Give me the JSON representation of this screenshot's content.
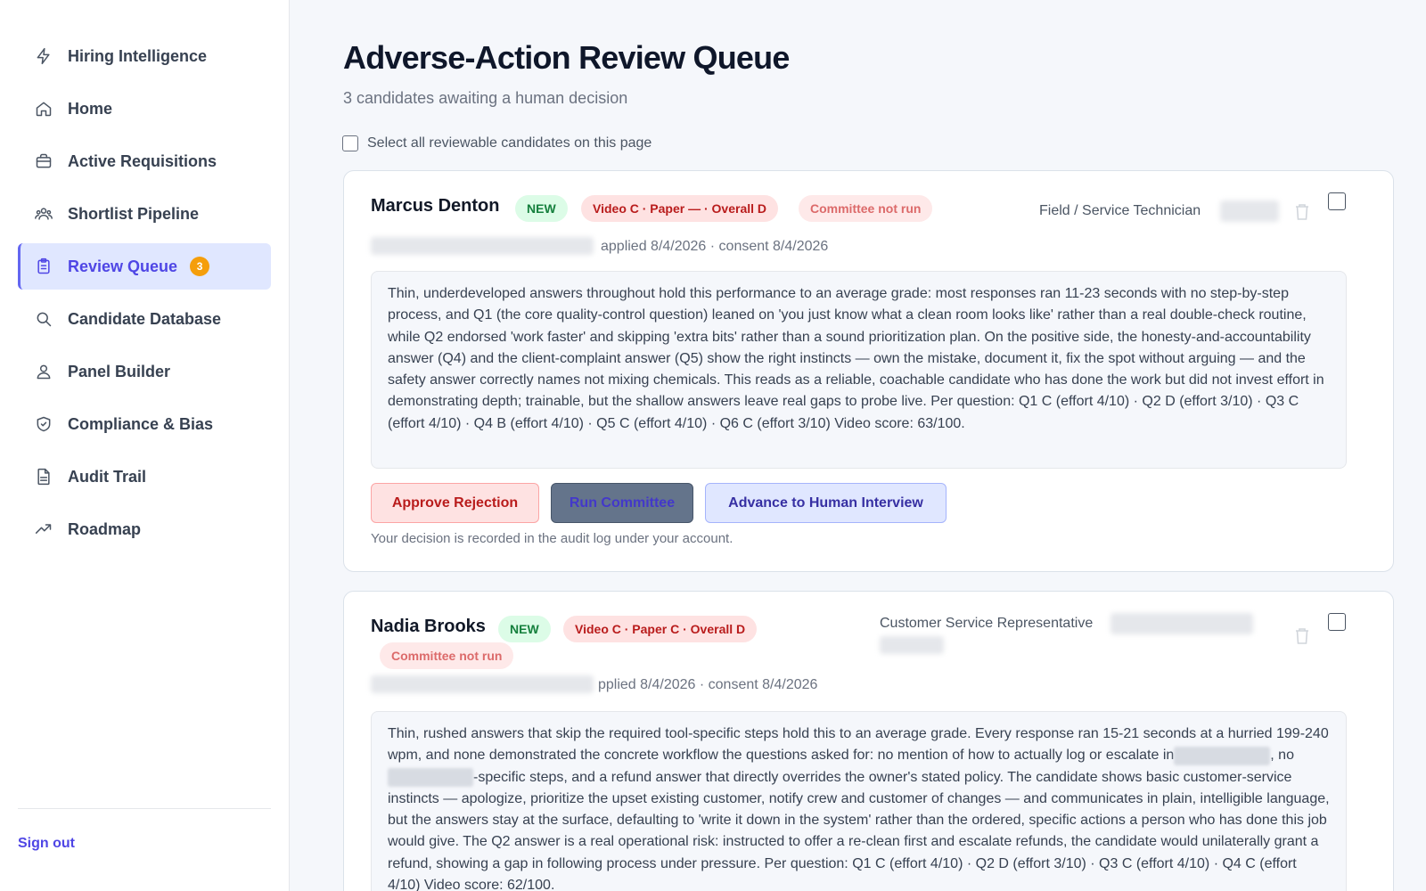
{
  "sidebar": {
    "items": [
      {
        "label": "Hiring Intelligence",
        "icon": "bolt-icon"
      },
      {
        "label": "Home",
        "icon": "home-icon"
      },
      {
        "label": "Active Requisitions",
        "icon": "briefcase-icon"
      },
      {
        "label": "Shortlist Pipeline",
        "icon": "users-icon"
      },
      {
        "label": "Review Queue",
        "icon": "clipboard-icon",
        "badge": "3",
        "active": true
      },
      {
        "label": "Candidate Database",
        "icon": "search-icon"
      },
      {
        "label": "Panel Builder",
        "icon": "user-group-icon"
      },
      {
        "label": "Compliance & Bias",
        "icon": "shield-icon"
      },
      {
        "label": "Audit Trail",
        "icon": "document-icon"
      },
      {
        "label": "Roadmap",
        "icon": "trending-icon"
      }
    ],
    "sign_out": "Sign out"
  },
  "main": {
    "title": "Adverse-Action Review Queue",
    "subtitle": "3 candidates awaiting a human decision",
    "select_all_label": "Select all reviewable candidates on this page"
  },
  "candidates": [
    {
      "name": "Marcus Denton",
      "status": "NEW",
      "grade": "Video C · Paper — · Overall D",
      "committee": "Committee not run",
      "role": "Field / Service Technician",
      "meta": "applied 8/4/2026 · consent 8/4/2026",
      "summary": "Thin, underdeveloped answers throughout hold this performance to an average grade: most responses ran 11-23 seconds with no step-by-step process, and Q1 (the core quality-control question) leaned on 'you just know what a clean room looks like' rather than a real double-check routine, while Q2 endorsed 'work faster' and skipping 'extra bits' rather than a sound prioritization plan. On the positive side, the honesty-and-accountability answer (Q4) and the client-complaint answer (Q5) show the right instincts — own the mistake, document it, fix the spot without arguing — and the safety answer correctly names not mixing chemicals. This reads as a reliable, coachable candidate who has done the work but did not invest effort in demonstrating depth; trainable, but the shallow answers leave real gaps to probe live. Per question: Q1 C (effort 4/10) · Q2 D (effort 3/10) · Q3 C (effort 4/10) · Q4 B (effort 4/10) · Q5 C (effort 4/10) · Q6 C (effort 3/10) Video score: 63/100.",
      "actions": {
        "approve": "Approve Rejection",
        "committee": "Run Committee",
        "advance": "Advance to Human Interview",
        "note": "Your decision is recorded in the audit log under your account."
      }
    },
    {
      "name": "Nadia Brooks",
      "status": "NEW",
      "grade": "Video C · Paper C · Overall D",
      "committee": "Committee not run",
      "role": "Customer Service Representative",
      "meta": "pplied 8/4/2026 · consent 8/4/2026",
      "summary_parts": [
        "Thin, rushed answers that skip the required tool-specific steps hold this to an average grade. Every response ran 15-21 seconds at a hurried 199-240 wpm, and none demonstrated the concrete workflow the questions asked for: no mention of how to actually log or escalate in",
        ", no",
        "-specific steps, and a refund answer that directly overrides the owner's stated policy. The candidate shows basic customer-service instincts — apologize, prioritize the upset existing customer, notify crew and customer of changes — and communicates in plain, intelligible language, but the answers stay at the surface, defaulting to 'write it down in the system' rather than the ordered, specific actions a person who has done this job would give. The Q2 answer is a real operational risk: instructed to offer a re-clean first and escalate refunds, the candidate would unilaterally grant a refund, showing a gap in following process under pressure. Per question: Q1 C (effort 4/10) · Q2 D (effort 3/10) · Q3 C (effort 4/10) · Q4 C (effort 4/10) Video score: 62/100."
      ]
    }
  ],
  "colors": {
    "accent": "#4f46e5",
    "badge": "#f59e0b",
    "danger": "#b91c1c",
    "success": "#15803d"
  }
}
